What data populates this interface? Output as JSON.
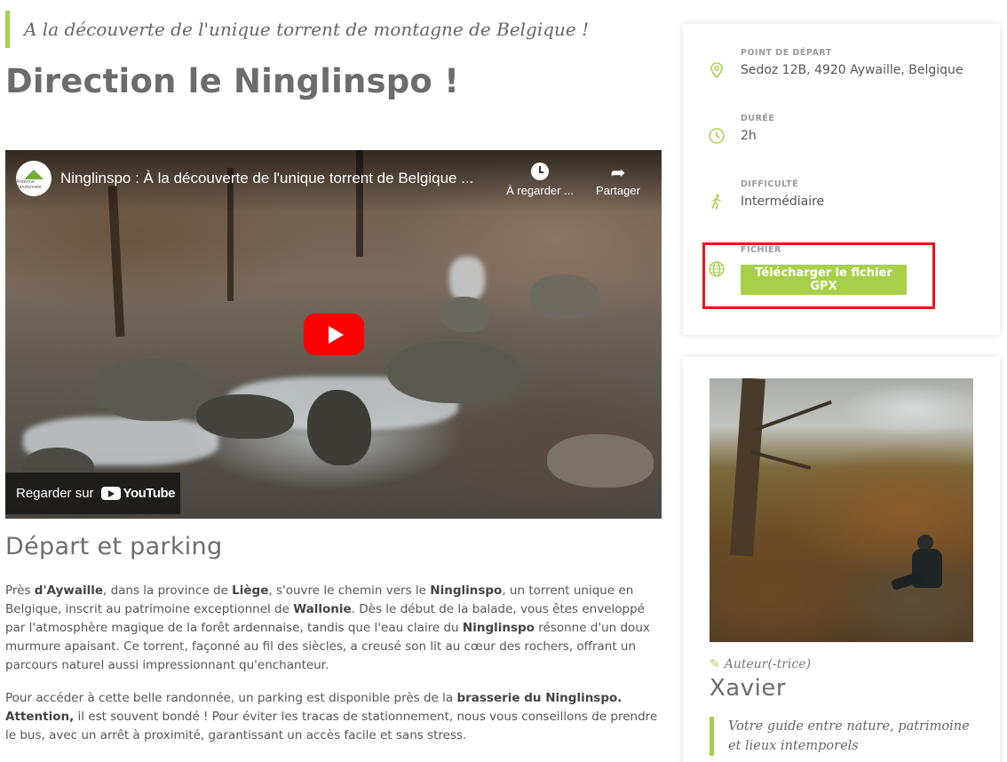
{
  "header": {
    "tagline": "A la découverte de l'unique torrent de montagne de Belgique !",
    "title": "Direction le Ninglinspo !"
  },
  "video": {
    "channel_logo_text": "Ardenne Randonnée",
    "title": "Ninglinspo : À la découverte de l'unique torrent de Belgique ...",
    "watch_later_label": "À regarder ...",
    "share_label": "Partager",
    "watch_on_label": "Regarder sur",
    "youtube_label": "YouTube"
  },
  "section": {
    "title": "Départ et parking"
  },
  "paragraphs": {
    "p1": {
      "t1": "Près ",
      "b1": "d'Aywaille",
      "t2": ", dans la province de ",
      "b2": "Liège",
      "t3": ", s'ouvre le chemin vers le ",
      "b3": "Ninglinspo",
      "t4": ", un torrent unique en Belgique, inscrit au patrimoine exceptionnel de ",
      "b4": "Wallonie",
      "t5": ". Dès le début de la balade, vous êtes enveloppé par l'atmosphère magique de la forêt ardennaise, tandis que l'eau claire du ",
      "b5": "Ninglinspo",
      "t6": " résonne d'un doux murmure apaisant. Ce torrent, façonné au fil des siècles, a creusé son lit au cœur des rochers, offrant un parcours naturel aussi impressionnant qu'enchanteur."
    },
    "p2": {
      "t1": "Pour accéder à cette belle randonnée, un parking est disponible près de la ",
      "b1": "brasserie du Ninglinspo. Attention,",
      "t2": " il est souvent bondé ! Pour éviter les tracas de stationnement, nous vous conseillons de prendre le bus, avec un arrêt à proximité, garantissant un accès facile et sans stress."
    }
  },
  "info_card": {
    "start": {
      "label": "POINT DE DÉPART",
      "value": "Sedoz 12B, 4920 Aywaille, Belgique",
      "icon": "location-pin-icon"
    },
    "duration": {
      "label": "DURÉE",
      "value": "2h",
      "icon": "clock-icon"
    },
    "difficulty": {
      "label": "DIFFICULTÉ",
      "value": "Intermédiaire",
      "icon": "hiker-icon"
    },
    "file": {
      "label": "FICHIER",
      "button_label": "Télécharger le fichier GPX",
      "icon": "globe-icon"
    },
    "highlight_color": "#e8141b"
  },
  "author_card": {
    "label": "Auteur(-trice)",
    "name": "Xavier",
    "quote": "Votre guide entre nature, patrimoine et lieux intemporels"
  },
  "colors": {
    "accent": "#a7d04a",
    "heading": "#6c6c6c",
    "text": "#555555",
    "youtube_red": "#ff0000"
  }
}
